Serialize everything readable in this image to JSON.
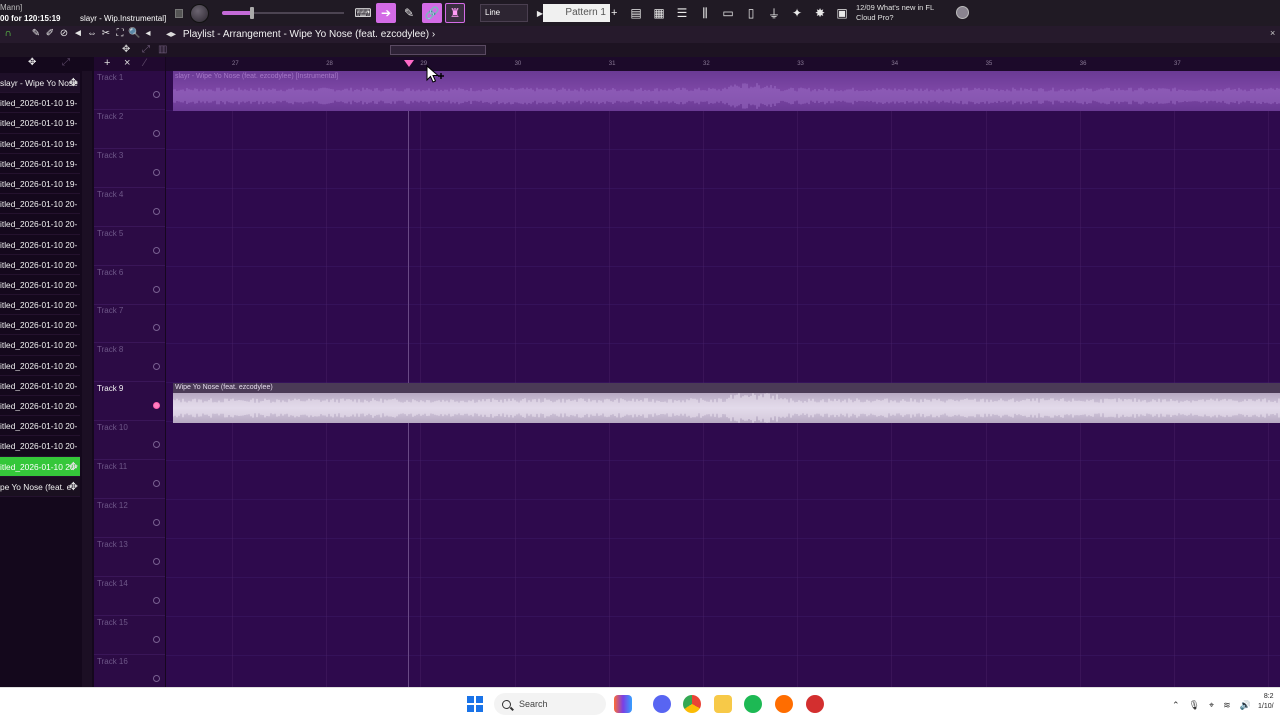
{
  "toolbar": {
    "user_label": "Mann]",
    "session_time": "00 for 120:15:19",
    "project_label": "slayr - Wip.Instrumental]",
    "snap_mode": "Line",
    "pattern_name": "Pattern 1",
    "pattern_add": "+",
    "news_line1": "12/09  What's new in FL",
    "news_line2": "Cloud Pro?"
  },
  "playlist": {
    "window_title": "Playlist - Arrangement",
    "breadcrumb_sep": "›",
    "song_title": "Wipe Yo Nose (feat. ezcodylee)",
    "close": "×"
  },
  "browser": {
    "items": [
      {
        "label": "slayr - Wipe Yo Nose",
        "state": "header"
      },
      {
        "label": "itled_2026-01-10 19-",
        "state": "normal"
      },
      {
        "label": "itled_2026-01-10 19-",
        "state": "normal"
      },
      {
        "label": "itled_2026-01-10 19-",
        "state": "normal"
      },
      {
        "label": "itled_2026-01-10 19-",
        "state": "normal"
      },
      {
        "label": "itled_2026-01-10 19-",
        "state": "normal"
      },
      {
        "label": "itled_2026-01-10 20-",
        "state": "normal"
      },
      {
        "label": "itled_2026-01-10 20-",
        "state": "normal"
      },
      {
        "label": "itled_2026-01-10 20-",
        "state": "normal"
      },
      {
        "label": "itled_2026-01-10 20-",
        "state": "normal"
      },
      {
        "label": "itled_2026-01-10 20-",
        "state": "normal"
      },
      {
        "label": "itled_2026-01-10 20-",
        "state": "normal"
      },
      {
        "label": "itled_2026-01-10 20-",
        "state": "normal"
      },
      {
        "label": "itled_2026-01-10 20-",
        "state": "normal"
      },
      {
        "label": "itled_2026-01-10 20-",
        "state": "normal"
      },
      {
        "label": "itled_2026-01-10 20-",
        "state": "normal"
      },
      {
        "label": "itled_2026-01-10 20-",
        "state": "normal"
      },
      {
        "label": "itled_2026-01-10 20-",
        "state": "normal"
      },
      {
        "label": "itled_2026-01-10 20-",
        "state": "normal"
      },
      {
        "label": "itled_2026-01-10 20-",
        "state": "selected"
      },
      {
        "label": "pe Yo Nose (feat. e",
        "state": "dark"
      }
    ]
  },
  "tracks": [
    {
      "name": "Track 1",
      "active": false
    },
    {
      "name": "Track 2",
      "active": false
    },
    {
      "name": "Track 3",
      "active": false
    },
    {
      "name": "Track 4",
      "active": false
    },
    {
      "name": "Track 5",
      "active": false
    },
    {
      "name": "Track 6",
      "active": false
    },
    {
      "name": "Track 7",
      "active": false
    },
    {
      "name": "Track 8",
      "active": false
    },
    {
      "name": "Track 9",
      "active": true
    },
    {
      "name": "Track 10",
      "active": false
    },
    {
      "name": "Track 11",
      "active": false
    },
    {
      "name": "Track 12",
      "active": false
    },
    {
      "name": "Track 13",
      "active": false
    },
    {
      "name": "Track 14",
      "active": false
    },
    {
      "name": "Track 15",
      "active": false
    },
    {
      "name": "Track 16",
      "active": false
    }
  ],
  "timeline": {
    "bars": [
      "27",
      "28",
      "29",
      "30",
      "31",
      "32",
      "33",
      "34",
      "35",
      "36",
      "37"
    ]
  },
  "clips": {
    "top_label": "slayr - Wipe Yo Nose (feat. ezcodylee) [Instrumental]",
    "bottom_label": "Wipe Yo Nose (feat. ezcodylee)"
  },
  "taskbar": {
    "search_placeholder": "Search",
    "time": "8:2",
    "date": "1/10/"
  },
  "colors": {
    "accent": "#d36be6",
    "selected_item": "#35c73a",
    "playlist_bg": "#2e0a4d"
  }
}
